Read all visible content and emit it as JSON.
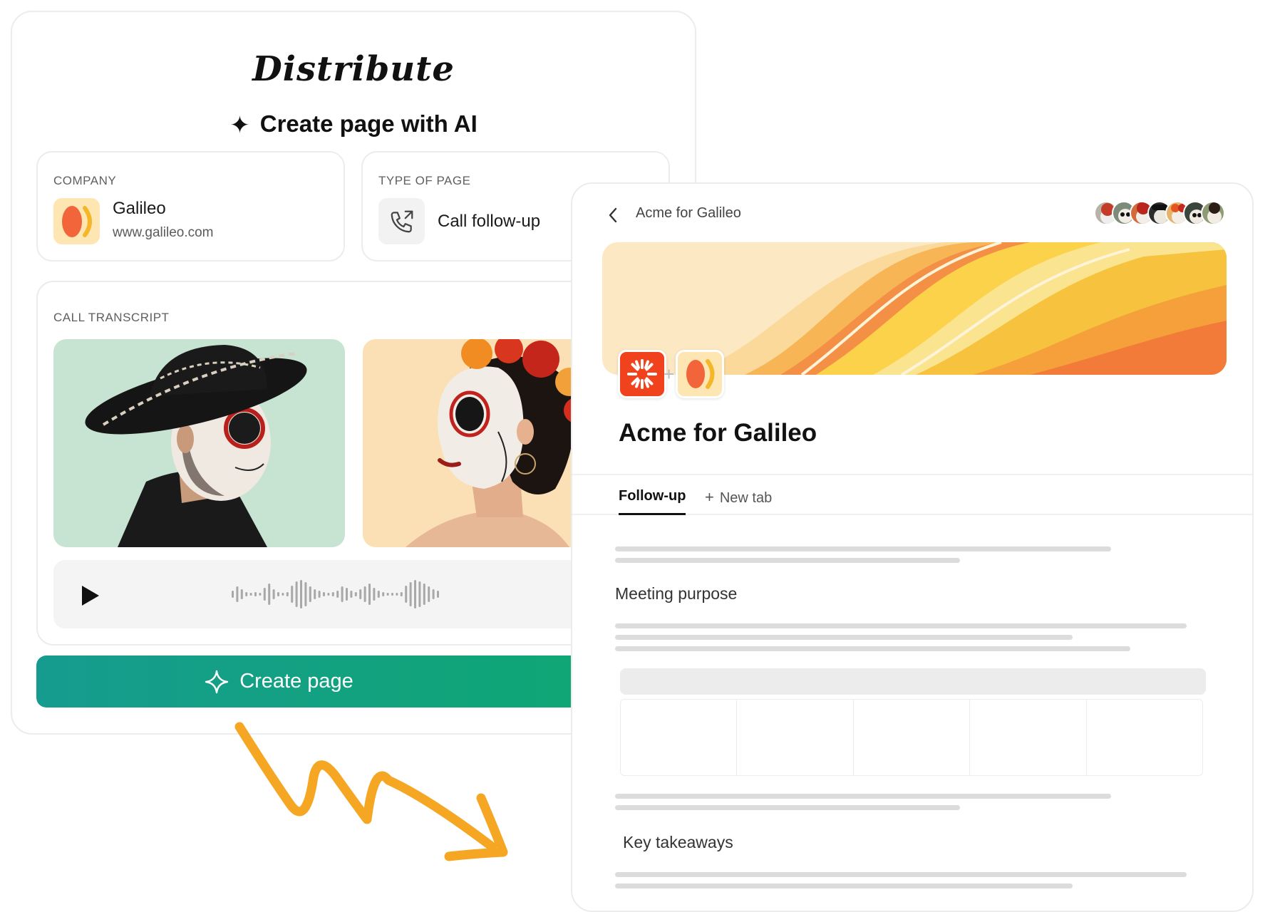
{
  "brand": "Distribute",
  "ai_title": "Create page with AI",
  "company": {
    "label": "COMPANY",
    "name": "Galileo",
    "url": "www.galileo.com"
  },
  "page_type": {
    "label": "TYPE OF PAGE",
    "value": "Call follow-up"
  },
  "transcript": {
    "label": "CALL TRANSCRIPT"
  },
  "create_button": "Create page",
  "preview": {
    "breadcrumb": "Acme for Galileo",
    "title": "Acme for Galileo",
    "tabs": {
      "active": "Follow-up",
      "new": "New tab"
    },
    "sections": {
      "meeting_purpose": "Meeting purpose",
      "key_takeaways": "Key takeaways"
    }
  },
  "colors": {
    "accent_green": "#0ea870",
    "accent_teal": "#169c8f",
    "arrow": "#f5a623",
    "acme_red": "#f0421c"
  },
  "icons": [
    "sparkle-icon",
    "phone-outgoing-icon",
    "play-icon",
    "back-chevron-icon",
    "plus-icon"
  ]
}
